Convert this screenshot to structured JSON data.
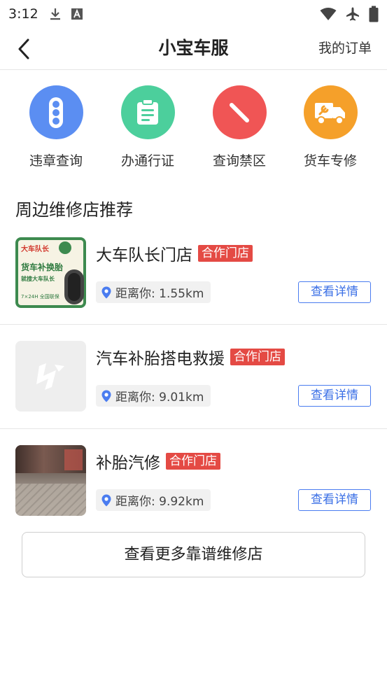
{
  "status_bar": {
    "time": "3:12",
    "left_icons": [
      "download-icon",
      "text-a-icon"
    ],
    "right_icons": [
      "wifi-icon",
      "airplane-icon",
      "battery-icon"
    ]
  },
  "nav": {
    "title": "小宝车服",
    "right_link": "我的订单",
    "back_icon": "chevron-left-icon"
  },
  "quick_actions": [
    {
      "label": "违章查询",
      "icon": "traffic-light-icon",
      "color": "#5b8ef2"
    },
    {
      "label": "办通行证",
      "icon": "clipboard-icon",
      "color": "#4ccf9c"
    },
    {
      "label": "查询禁区",
      "icon": "no-entry-icon",
      "color": "#f05555"
    },
    {
      "label": "货车专修",
      "icon": "repair-truck-icon",
      "color": "#f5a02a"
    }
  ],
  "section": {
    "title": "周边维修店推荐"
  },
  "shops": [
    {
      "name": "大车队长门店",
      "badge": "合作门店",
      "distance": "距离你: 1.55km",
      "detail_label": "查看详情",
      "thumb": {
        "brand": "大车队长",
        "line1": "货车补换胎",
        "line2": "就搜大车队长",
        "line3": "7×24H 全国联保"
      }
    },
    {
      "name": "汽车补胎搭电救援",
      "badge": "合作门店",
      "distance": "距离你: 9.01km",
      "detail_label": "查看详情"
    },
    {
      "name": "补胎汽修",
      "badge": "合作门店",
      "distance": "距离你: 9.92km",
      "detail_label": "查看详情"
    }
  ],
  "more_button": "查看更多靠谱维修店",
  "colors": {
    "accent_blue": "#3a6fe6",
    "badge_red": "#e44a44",
    "divider": "#e6e6e6"
  }
}
